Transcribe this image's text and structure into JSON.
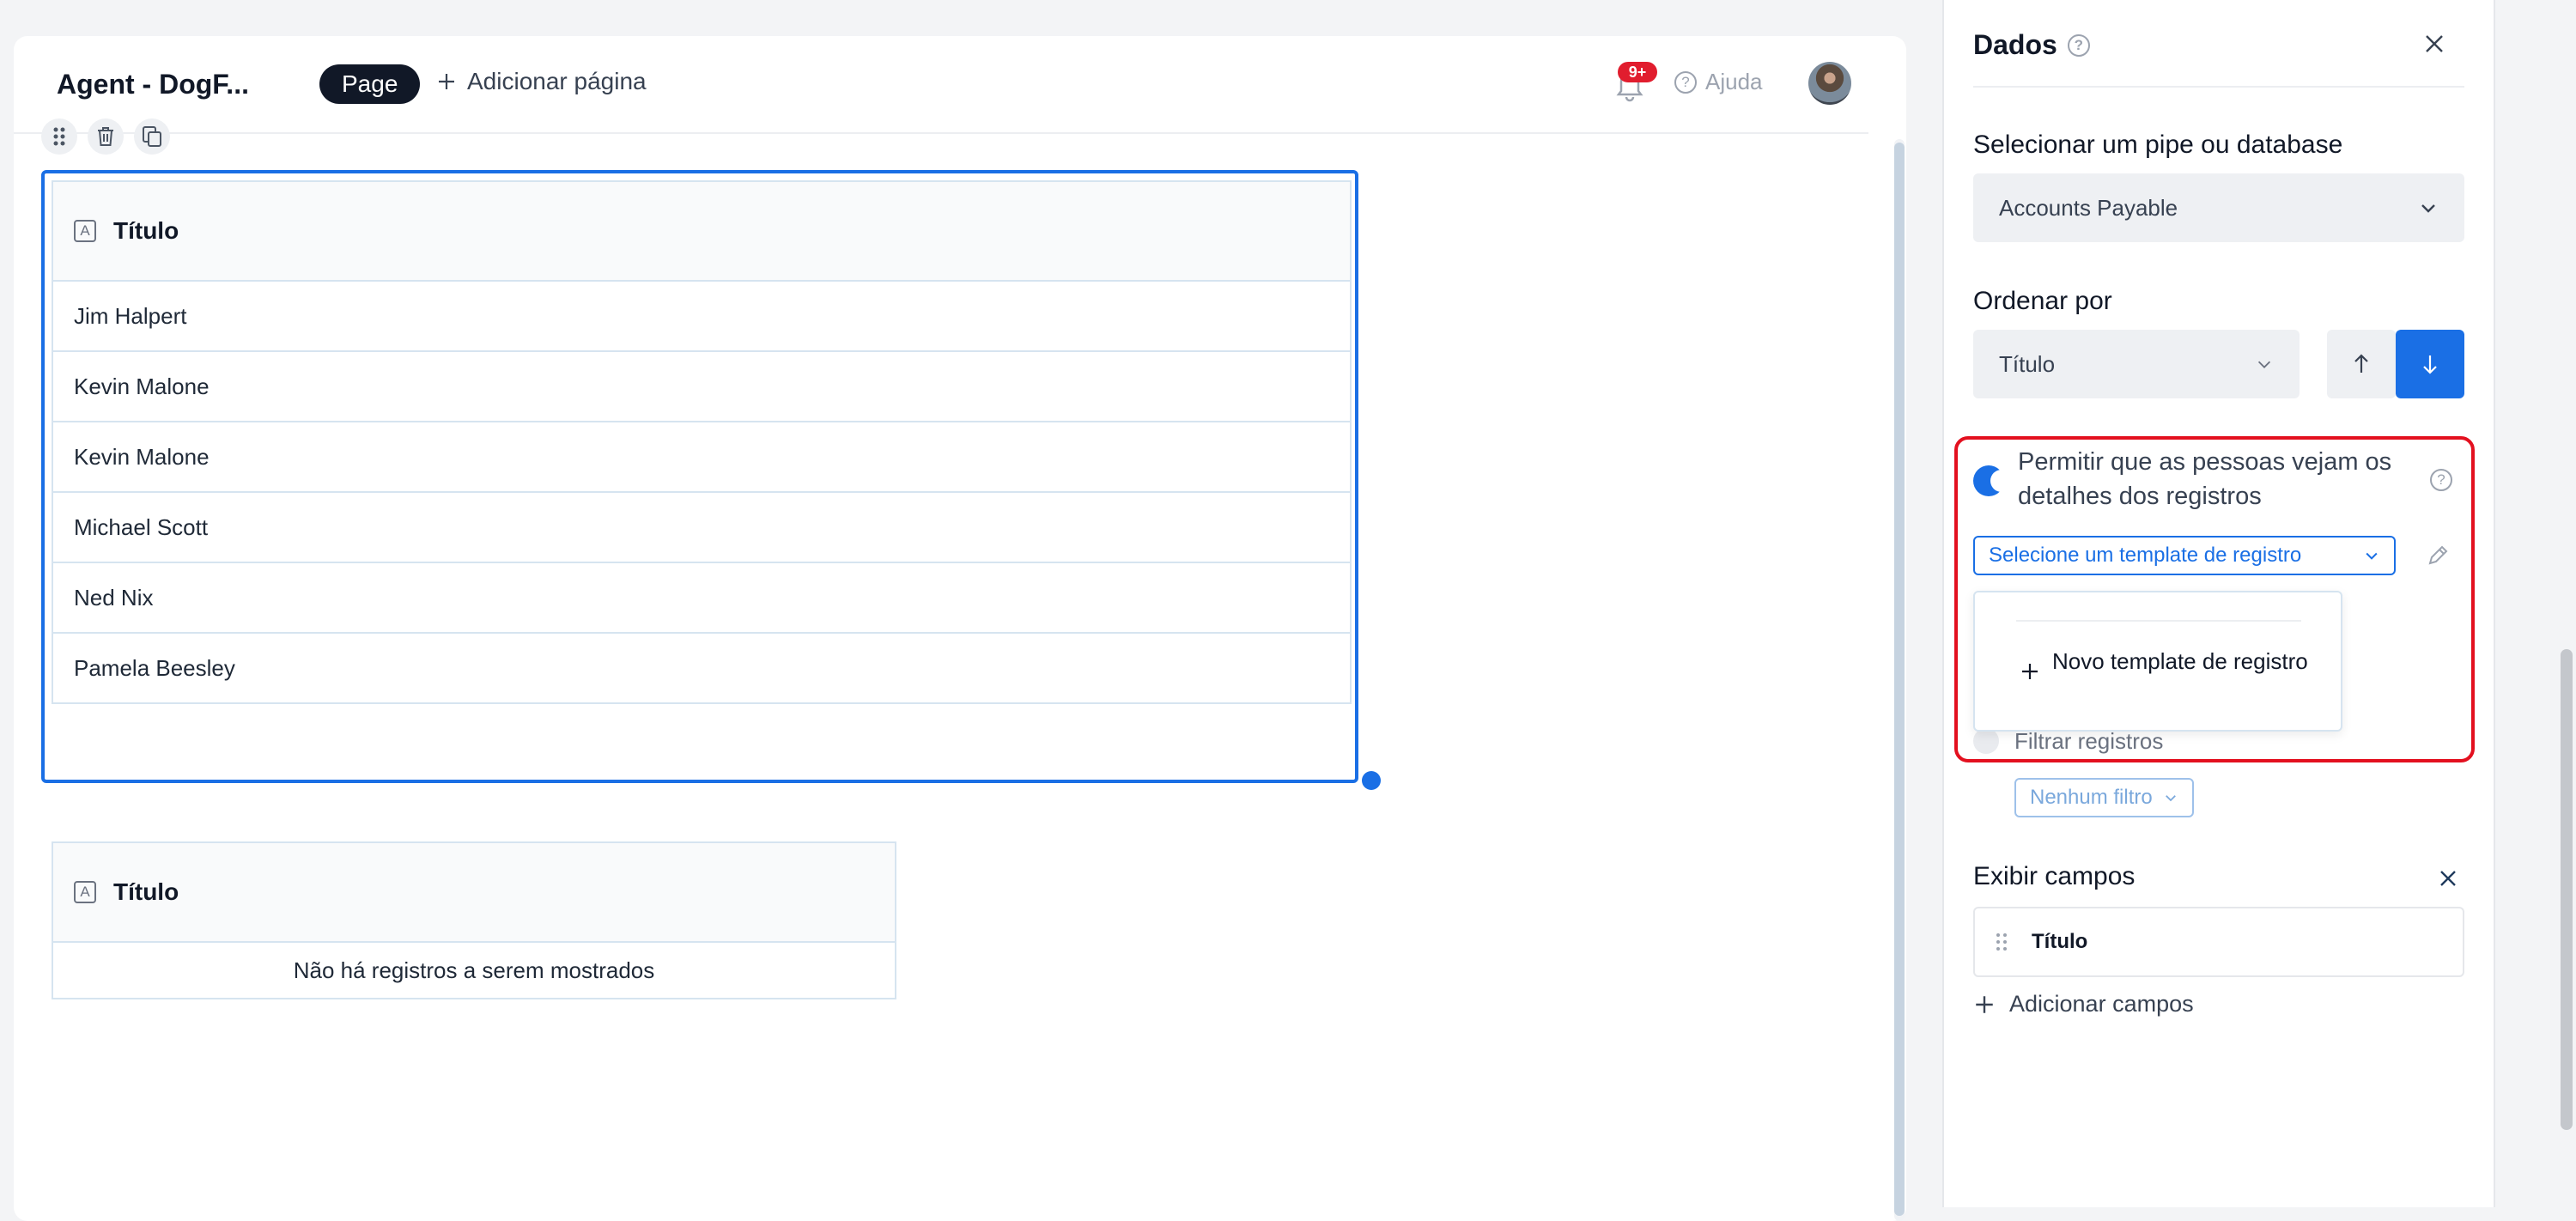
{
  "header": {
    "app_title": "Agent - DogF...",
    "page_pill": "Page",
    "add_page": "Adicionar página",
    "notification_badge": "9+",
    "help": "Ajuda"
  },
  "main_table": {
    "column": "Título",
    "rows": [
      "Jim Halpert",
      "Kevin Malone",
      "Kevin Malone",
      "Michael Scott",
      "Ned Nix",
      "Pamela Beesley"
    ]
  },
  "second_table": {
    "column": "Título",
    "empty_message": "Não há registros a serem mostrados"
  },
  "panel": {
    "title": "Dados",
    "pipe_label": "Selecionar um pipe ou database",
    "pipe_value": "Accounts Payable",
    "order_label": "Ordenar por",
    "order_value": "Título",
    "allow_details_text": "Permitir que as pessoas vejam os detalhes dos registros",
    "allow_details_enabled": true,
    "template_select": "Selecione um template de registro",
    "new_template": "Novo template de registro",
    "filter_label": "Filtrar registros",
    "filter_button": "Nenhum filtro",
    "fields_label": "Exibir campos",
    "fields": [
      "Título"
    ],
    "add_fields": "Adicionar campos"
  },
  "colors": {
    "accent": "#1a6fe5",
    "highlight": "#e3101f",
    "badge": "#e11d2e"
  }
}
